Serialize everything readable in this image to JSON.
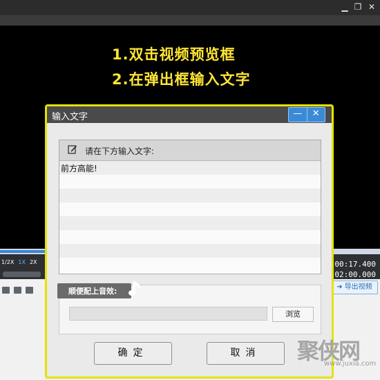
{
  "video": {
    "caption_line1": "1.双击视频预览框",
    "caption_line2": "2.在弹出框输入文字"
  },
  "player": {
    "speeds": [
      "1/2X",
      "1X",
      "2X"
    ],
    "active_speed": "1X",
    "time_current": "00:17.400",
    "time_total": "02:00.000",
    "export_label": "导出视频"
  },
  "dialog": {
    "title": "输入文字",
    "min_glyph": "—",
    "close_glyph": "✕",
    "panel_label": "请在下方输入文字:",
    "text_value": "前方高能!",
    "audio_label": "顺便配上音效:",
    "audio_path": "",
    "browse_label": "浏览",
    "ok_label": "确定",
    "cancel_label": "取消"
  },
  "watermark": {
    "logo": "聚侠网",
    "url": "www.juxia.com"
  },
  "colors": {
    "caption_yellow": "#ffe633",
    "dialog_border": "#e6e200",
    "accent_blue": "#3a8ad8"
  }
}
